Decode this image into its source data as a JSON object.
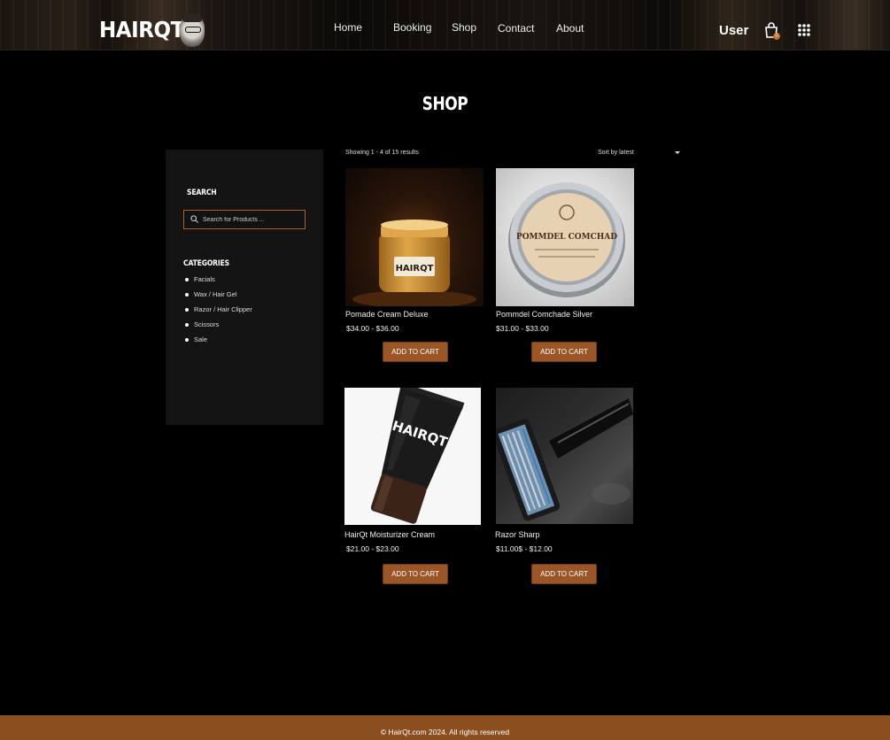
{
  "header": {
    "logo_text": "HAIRQT",
    "nav": [
      "Home",
      "Booking",
      "Shop",
      "Contact",
      "About"
    ],
    "user_label": "User",
    "cart_count": "0"
  },
  "page_title": "SHOP",
  "sidebar": {
    "search_heading": "SEARCH",
    "search_placeholder": "Search for Products ...",
    "categories_heading": "CATEGORIES",
    "categories": [
      "Facials",
      "Wax / Hair Gel",
      "Razor / Hair Clipper",
      "Scissors",
      "Sale"
    ]
  },
  "toolbar": {
    "results_text": "Showing 1 - 4 of 15 results",
    "sort_value": "Sort by latest"
  },
  "products": [
    {
      "name": "Pomade Cream Deluxe",
      "price": "$34.00 - $36.00",
      "button": "ADD TO CART",
      "image": "pomade-jar-image",
      "label": "HAIRQT"
    },
    {
      "name": "Pommdel Comchade Silver",
      "price": "$31.00 - $33.00",
      "button": "ADD TO CART",
      "image": "silver-tin-image",
      "label": "POMMDEL COMCHAD"
    },
    {
      "name": "HairQt Moisturizer Cream",
      "price": "$21.00 - $23.00",
      "button": "ADD TO CART",
      "image": "cream-tube-image",
      "label": "HAIRQT"
    },
    {
      "name": "Razor Sharp",
      "price": "$11.00$ - $12.00",
      "button": "ADD TO CART",
      "image": "razor-image",
      "label": ""
    }
  ],
  "footer": {
    "copyright": "© HairQt.com 2024. All rights reserved"
  },
  "colors": {
    "accent": "#9a5626",
    "footer": "#8b4f1f",
    "background": "#000000",
    "sidebar": "#141414"
  }
}
